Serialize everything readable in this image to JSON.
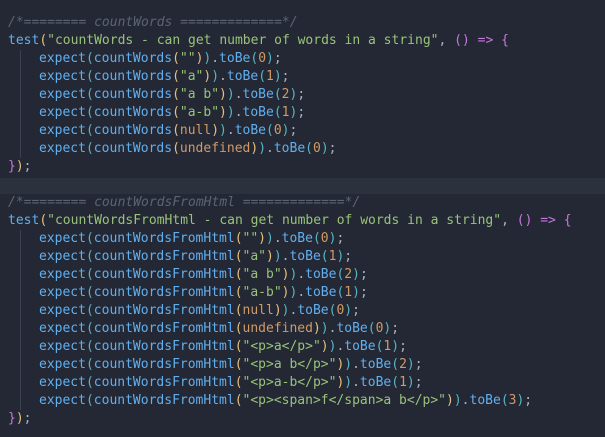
{
  "editor": {
    "blocks": [
      {
        "comment": "/*======== countWords =============*/",
        "test": {
          "fn": "test",
          "desc": "\"countWords - can get number of words in a string\"",
          "arrow": "=>"
        },
        "lines": [
          {
            "fn": "countWords",
            "arg": "\"\"",
            "arg_type": "str",
            "expected": "0"
          },
          {
            "fn": "countWords",
            "arg": "\"a\"",
            "arg_type": "str",
            "expected": "1"
          },
          {
            "fn": "countWords",
            "arg": "\"a b\"",
            "arg_type": "str",
            "expected": "2"
          },
          {
            "fn": "countWords",
            "arg": "\"a-b\"",
            "arg_type": "str",
            "expected": "1"
          },
          {
            "fn": "countWords",
            "arg": "null",
            "arg_type": "kw",
            "expected": "0"
          },
          {
            "fn": "countWords",
            "arg": "undefined",
            "arg_type": "kw",
            "expected": "0"
          }
        ]
      },
      {
        "comment": "/*======== countWordsFromHtml =============*/",
        "test": {
          "fn": "test",
          "desc": "\"countWordsFromHtml - can get number of words in a string\"",
          "arrow": "=>"
        },
        "lines": [
          {
            "fn": "countWordsFromHtml",
            "arg": "\"\"",
            "arg_type": "str",
            "expected": "0"
          },
          {
            "fn": "countWordsFromHtml",
            "arg": "\"a\"",
            "arg_type": "str",
            "expected": "1"
          },
          {
            "fn": "countWordsFromHtml",
            "arg": "\"a b\"",
            "arg_type": "str",
            "expected": "2"
          },
          {
            "fn": "countWordsFromHtml",
            "arg": "\"a-b\"",
            "arg_type": "str",
            "expected": "1"
          },
          {
            "fn": "countWordsFromHtml",
            "arg": "null",
            "arg_type": "kw",
            "expected": "0"
          },
          {
            "fn": "countWordsFromHtml",
            "arg": "undefined",
            "arg_type": "kw",
            "expected": "0"
          },
          {
            "fn": "countWordsFromHtml",
            "arg": "\"<p>a</p>\"",
            "arg_type": "str",
            "expected": "1"
          },
          {
            "fn": "countWordsFromHtml",
            "arg": "\"<p>a b</p>\"",
            "arg_type": "str",
            "expected": "2"
          },
          {
            "fn": "countWordsFromHtml",
            "arg": "\"<p>a-b</p>\"",
            "arg_type": "str",
            "expected": "1"
          },
          {
            "fn": "countWordsFromHtml",
            "arg": "\"<p><span>f</span>a b</p>\"",
            "arg_type": "str",
            "expected": "3"
          }
        ]
      }
    ],
    "tokens": {
      "expect": "expect",
      "toBe": "toBe",
      "close": "});"
    },
    "colors": {
      "background": "#232834",
      "separator": "#2b313d",
      "comment": "#5c6473",
      "function": "#61afef",
      "string": "#98c379",
      "number": "#d19a66",
      "bracket_level_1": "#e5c07b",
      "bracket_level_2": "#c678dd",
      "bracket_level_3": "#56b6c2"
    }
  }
}
